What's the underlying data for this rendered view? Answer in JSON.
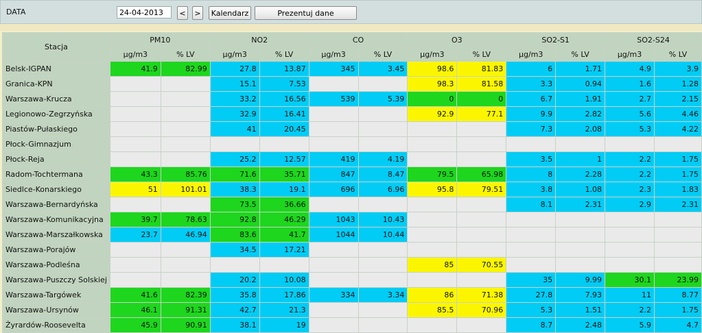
{
  "controls": {
    "date_label": "DATA",
    "date_value": "24-04-2013",
    "prev_label": "<",
    "next_label": ">",
    "calendar_label": "Kalendarz",
    "present_label": "Prezentuj dane"
  },
  "table": {
    "station_header": "Stacja",
    "groups": [
      "PM10",
      "NO2",
      "CO",
      "O3",
      "SO2-S1",
      "SO2-S24"
    ],
    "subheaders": [
      "µg/m3",
      "% LV"
    ],
    "rows": [
      {
        "name": "Belsk-IGPAN",
        "cells": [
          [
            "41.9",
            "g"
          ],
          [
            "82.99",
            "g"
          ],
          [
            "27.8",
            "b"
          ],
          [
            "13.87",
            "b"
          ],
          [
            "345",
            "b"
          ],
          [
            "3.45",
            "b"
          ],
          [
            "98.6",
            "y"
          ],
          [
            "81.83",
            "y"
          ],
          [
            "6",
            "b"
          ],
          [
            "1.71",
            "b"
          ],
          [
            "4.9",
            "b"
          ],
          [
            "3.9",
            "b"
          ]
        ]
      },
      {
        "name": "Granica-KPN",
        "cells": [
          [
            "",
            ""
          ],
          [
            "",
            ""
          ],
          [
            "15.1",
            "b"
          ],
          [
            "7.53",
            "b"
          ],
          [
            "",
            ""
          ],
          [
            "",
            ""
          ],
          [
            "98.3",
            "y"
          ],
          [
            "81.58",
            "y"
          ],
          [
            "3.3",
            "b"
          ],
          [
            "0.94",
            "b"
          ],
          [
            "1.6",
            "b"
          ],
          [
            "1.28",
            "b"
          ]
        ]
      },
      {
        "name": "Warszawa-Krucza",
        "cells": [
          [
            "",
            ""
          ],
          [
            "",
            ""
          ],
          [
            "33.2",
            "b"
          ],
          [
            "16.56",
            "b"
          ],
          [
            "539",
            "b"
          ],
          [
            "5.39",
            "b"
          ],
          [
            "0",
            "g"
          ],
          [
            "0",
            "g"
          ],
          [
            "6.7",
            "b"
          ],
          [
            "1.91",
            "b"
          ],
          [
            "2.7",
            "b"
          ],
          [
            "2.15",
            "b"
          ]
        ]
      },
      {
        "name": "Legionowo-Zegrzyńska",
        "cells": [
          [
            "",
            ""
          ],
          [
            "",
            ""
          ],
          [
            "32.9",
            "b"
          ],
          [
            "16.41",
            "b"
          ],
          [
            "",
            ""
          ],
          [
            "",
            ""
          ],
          [
            "92.9",
            "y"
          ],
          [
            "77.1",
            "y"
          ],
          [
            "9.9",
            "b"
          ],
          [
            "2.82",
            "b"
          ],
          [
            "5.6",
            "b"
          ],
          [
            "4.46",
            "b"
          ]
        ]
      },
      {
        "name": "Piastów-Pułaskiego",
        "cells": [
          [
            "",
            ""
          ],
          [
            "",
            ""
          ],
          [
            "41",
            "b"
          ],
          [
            "20.45",
            "b"
          ],
          [
            "",
            ""
          ],
          [
            "",
            ""
          ],
          [
            "",
            ""
          ],
          [
            "",
            ""
          ],
          [
            "7.3",
            "b"
          ],
          [
            "2.08",
            "b"
          ],
          [
            "5.3",
            "b"
          ],
          [
            "4.22",
            "b"
          ]
        ]
      },
      {
        "name": "Płock-Gimnazjum",
        "cells": [
          [
            "",
            ""
          ],
          [
            "",
            ""
          ],
          [
            "",
            ""
          ],
          [
            "",
            ""
          ],
          [
            "",
            ""
          ],
          [
            "",
            ""
          ],
          [
            "",
            ""
          ],
          [
            "",
            ""
          ],
          [
            "",
            ""
          ],
          [
            "",
            ""
          ],
          [
            "",
            ""
          ],
          [
            "",
            ""
          ]
        ]
      },
      {
        "name": "Płock-Reja",
        "cells": [
          [
            "",
            ""
          ],
          [
            "",
            ""
          ],
          [
            "25.2",
            "b"
          ],
          [
            "12.57",
            "b"
          ],
          [
            "419",
            "b"
          ],
          [
            "4.19",
            "b"
          ],
          [
            "",
            ""
          ],
          [
            "",
            ""
          ],
          [
            "3.5",
            "b"
          ],
          [
            "1",
            "b"
          ],
          [
            "2.2",
            "b"
          ],
          [
            "1.75",
            "b"
          ]
        ]
      },
      {
        "name": "Radom-Tochtermana",
        "cells": [
          [
            "43.3",
            "g"
          ],
          [
            "85.76",
            "g"
          ],
          [
            "71.6",
            "g"
          ],
          [
            "35.71",
            "g"
          ],
          [
            "847",
            "b"
          ],
          [
            "8.47",
            "b"
          ],
          [
            "79.5",
            "g"
          ],
          [
            "65.98",
            "g"
          ],
          [
            "8",
            "b"
          ],
          [
            "2.28",
            "b"
          ],
          [
            "2.2",
            "b"
          ],
          [
            "1.75",
            "b"
          ]
        ]
      },
      {
        "name": "Siedlce-Konarskiego",
        "cells": [
          [
            "51",
            "y"
          ],
          [
            "101.01",
            "y"
          ],
          [
            "38.3",
            "b"
          ],
          [
            "19.1",
            "b"
          ],
          [
            "696",
            "b"
          ],
          [
            "6.96",
            "b"
          ],
          [
            "95.8",
            "y"
          ],
          [
            "79.51",
            "y"
          ],
          [
            "3.8",
            "b"
          ],
          [
            "1.08",
            "b"
          ],
          [
            "2.3",
            "b"
          ],
          [
            "1.83",
            "b"
          ]
        ]
      },
      {
        "name": "Warszawa-Bernardyńska",
        "cells": [
          [
            "",
            ""
          ],
          [
            "",
            ""
          ],
          [
            "73.5",
            "g"
          ],
          [
            "36.66",
            "g"
          ],
          [
            "",
            ""
          ],
          [
            "",
            ""
          ],
          [
            "",
            ""
          ],
          [
            "",
            ""
          ],
          [
            "8.1",
            "b"
          ],
          [
            "2.31",
            "b"
          ],
          [
            "2.9",
            "b"
          ],
          [
            "2.31",
            "b"
          ]
        ]
      },
      {
        "name": "Warszawa-Komunikacyjna",
        "cells": [
          [
            "39.7",
            "g"
          ],
          [
            "78.63",
            "g"
          ],
          [
            "92.8",
            "g"
          ],
          [
            "46.29",
            "g"
          ],
          [
            "1043",
            "b"
          ],
          [
            "10.43",
            "b"
          ],
          [
            "",
            ""
          ],
          [
            "",
            ""
          ],
          [
            "",
            ""
          ],
          [
            "",
            ""
          ],
          [
            "",
            ""
          ],
          [
            "",
            ""
          ]
        ]
      },
      {
        "name": "Warszawa-Marszałkowska",
        "cells": [
          [
            "23.7",
            "b"
          ],
          [
            "46.94",
            "b"
          ],
          [
            "83.6",
            "g"
          ],
          [
            "41.7",
            "g"
          ],
          [
            "1044",
            "b"
          ],
          [
            "10.44",
            "b"
          ],
          [
            "",
            ""
          ],
          [
            "",
            ""
          ],
          [
            "",
            ""
          ],
          [
            "",
            ""
          ],
          [
            "",
            ""
          ],
          [
            "",
            ""
          ]
        ]
      },
      {
        "name": "Warszawa-Porajów",
        "cells": [
          [
            "",
            ""
          ],
          [
            "",
            ""
          ],
          [
            "34.5",
            "b"
          ],
          [
            "17.21",
            "b"
          ],
          [
            "",
            ""
          ],
          [
            "",
            ""
          ],
          [
            "",
            ""
          ],
          [
            "",
            ""
          ],
          [
            "",
            ""
          ],
          [
            "",
            ""
          ],
          [
            "",
            ""
          ],
          [
            "",
            ""
          ]
        ]
      },
      {
        "name": "Warszawa-Podleśna",
        "cells": [
          [
            "",
            ""
          ],
          [
            "",
            ""
          ],
          [
            "",
            ""
          ],
          [
            "",
            ""
          ],
          [
            "",
            ""
          ],
          [
            "",
            ""
          ],
          [
            "85",
            "y"
          ],
          [
            "70.55",
            "y"
          ],
          [
            "",
            ""
          ],
          [
            "",
            ""
          ],
          [
            "",
            ""
          ],
          [
            "",
            ""
          ]
        ]
      },
      {
        "name": "Warszawa-Puszczy Solskiej",
        "cells": [
          [
            "",
            ""
          ],
          [
            "",
            ""
          ],
          [
            "20.2",
            "b"
          ],
          [
            "10.08",
            "b"
          ],
          [
            "",
            ""
          ],
          [
            "",
            ""
          ],
          [
            "",
            ""
          ],
          [
            "",
            ""
          ],
          [
            "35",
            "b"
          ],
          [
            "9.99",
            "b"
          ],
          [
            "30.1",
            "g"
          ],
          [
            "23.99",
            "g"
          ]
        ]
      },
      {
        "name": "Warszawa-Targówek",
        "cells": [
          [
            "41.6",
            "g"
          ],
          [
            "82.39",
            "g"
          ],
          [
            "35.8",
            "b"
          ],
          [
            "17.86",
            "b"
          ],
          [
            "334",
            "b"
          ],
          [
            "3.34",
            "b"
          ],
          [
            "86",
            "y"
          ],
          [
            "71.38",
            "y"
          ],
          [
            "27.8",
            "b"
          ],
          [
            "7.93",
            "b"
          ],
          [
            "11",
            "b"
          ],
          [
            "8.77",
            "b"
          ]
        ]
      },
      {
        "name": "Warszawa-Ursynów",
        "cells": [
          [
            "46.1",
            "g"
          ],
          [
            "91.31",
            "g"
          ],
          [
            "42.7",
            "b"
          ],
          [
            "21.3",
            "b"
          ],
          [
            "",
            ""
          ],
          [
            "",
            ""
          ],
          [
            "85.5",
            "y"
          ],
          [
            "70.96",
            "y"
          ],
          [
            "5.3",
            "b"
          ],
          [
            "1.51",
            "b"
          ],
          [
            "2.2",
            "b"
          ],
          [
            "1.75",
            "b"
          ]
        ]
      },
      {
        "name": "Żyrardów-Roosevelta",
        "cells": [
          [
            "45.9",
            "g"
          ],
          [
            "90.91",
            "g"
          ],
          [
            "38.1",
            "b"
          ],
          [
            "19",
            "b"
          ],
          [
            "",
            ""
          ],
          [
            "",
            ""
          ],
          [
            "",
            ""
          ],
          [
            "",
            ""
          ],
          [
            "8.7",
            "b"
          ],
          [
            "2.48",
            "b"
          ],
          [
            "5.9",
            "b"
          ],
          [
            "4.7",
            "b"
          ]
        ]
      }
    ]
  }
}
